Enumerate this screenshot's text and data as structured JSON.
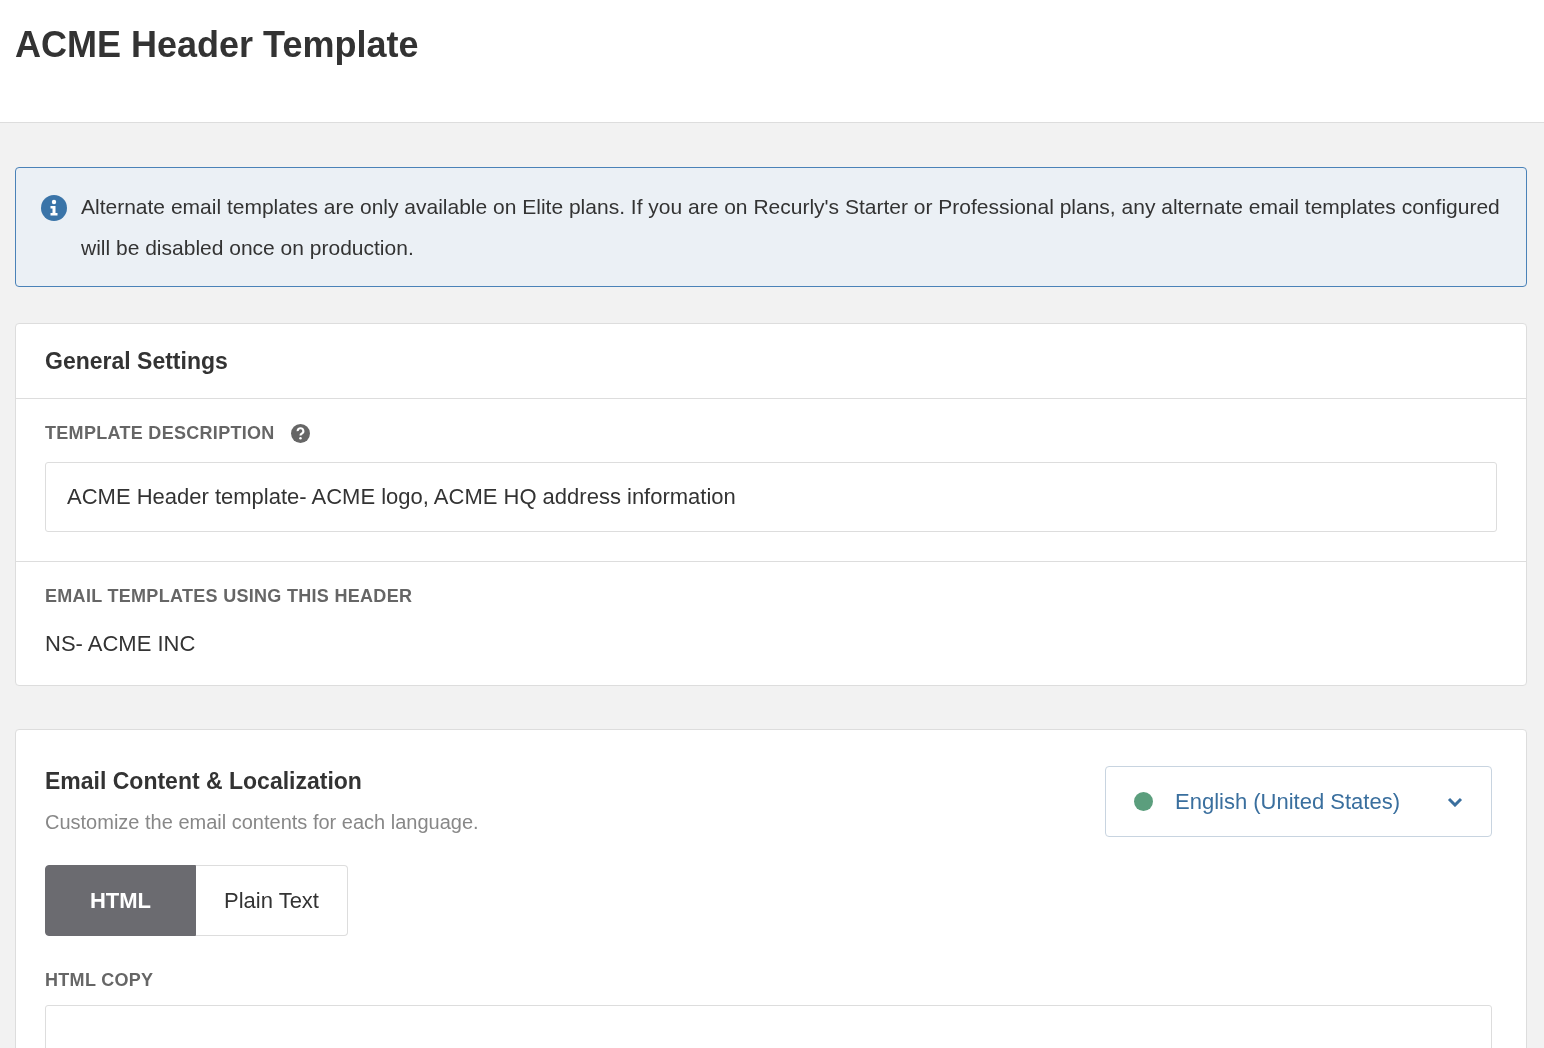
{
  "page": {
    "title": "ACME Header Template"
  },
  "notice": {
    "text": "Alternate email templates are only available on Elite plans. If you are on Recurly's Starter or Professional plans, any alternate email templates configured will be disabled once on production."
  },
  "general_settings": {
    "title": "General Settings",
    "template_description": {
      "label": "TEMPLATE DESCRIPTION",
      "value": "ACME Header template- ACME logo, ACME HQ address information"
    },
    "email_templates": {
      "label": "EMAIL TEMPLATES USING THIS HEADER",
      "value": "NS- ACME INC"
    }
  },
  "email_content": {
    "title": "Email Content & Localization",
    "subtitle": "Customize the email contents for each language.",
    "language": {
      "value": "English (United States)",
      "color": "#5b9e7d"
    },
    "tabs": [
      {
        "label": "HTML",
        "selected": true
      },
      {
        "label": "Plain Text",
        "selected": false
      }
    ],
    "html_copy": {
      "label": "HTML COPY"
    }
  }
}
